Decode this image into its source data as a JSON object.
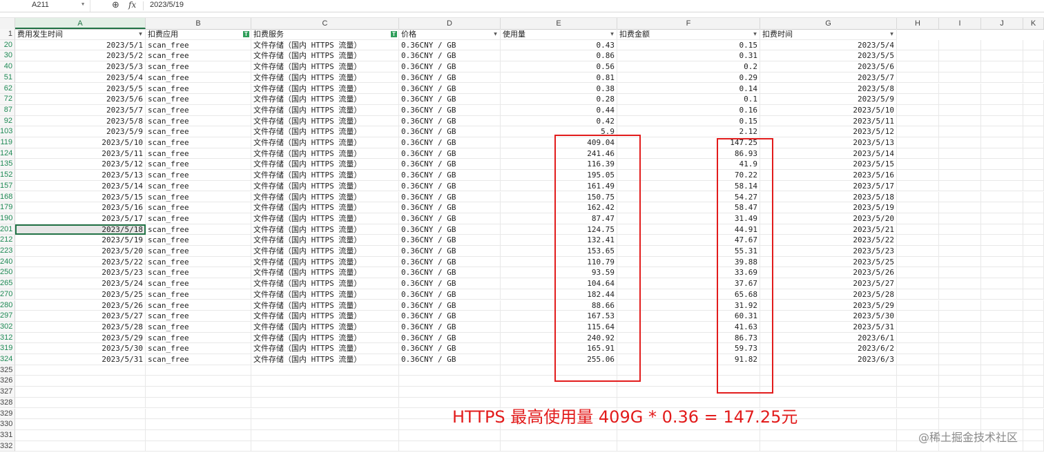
{
  "formula_bar": {
    "cell_ref": "A211",
    "formula": "2023/5/19"
  },
  "columns": [
    "A",
    "B",
    "C",
    "D",
    "E",
    "F",
    "G",
    "H",
    "I",
    "J",
    "K"
  ],
  "headers": [
    "费用发生时间",
    "扣费应用",
    "扣费服务",
    "价格",
    "使用量",
    "扣费金额",
    "扣费时间"
  ],
  "header_row_num": "1",
  "rows": [
    {
      "num": "20",
      "date": "2023/5/1",
      "app": "scan_free",
      "service": "文件存储（国内 HTTPS 流量）",
      "price": "0.36CNY / GB",
      "usage": "0.43",
      "amount": "0.15",
      "charge_time": "2023/5/4"
    },
    {
      "num": "30",
      "date": "2023/5/2",
      "app": "scan_free",
      "service": "文件存储（国内 HTTPS 流量）",
      "price": "0.36CNY / GB",
      "usage": "0.86",
      "amount": "0.31",
      "charge_time": "2023/5/5"
    },
    {
      "num": "40",
      "date": "2023/5/3",
      "app": "scan_free",
      "service": "文件存储（国内 HTTPS 流量）",
      "price": "0.36CNY / GB",
      "usage": "0.56",
      "amount": "0.2",
      "charge_time": "2023/5/6"
    },
    {
      "num": "51",
      "date": "2023/5/4",
      "app": "scan_free",
      "service": "文件存储（国内 HTTPS 流量）",
      "price": "0.36CNY / GB",
      "usage": "0.81",
      "amount": "0.29",
      "charge_time": "2023/5/7"
    },
    {
      "num": "62",
      "date": "2023/5/5",
      "app": "scan_free",
      "service": "文件存储（国内 HTTPS 流量）",
      "price": "0.36CNY / GB",
      "usage": "0.38",
      "amount": "0.14",
      "charge_time": "2023/5/8"
    },
    {
      "num": "72",
      "date": "2023/5/6",
      "app": "scan_free",
      "service": "文件存储（国内 HTTPS 流量）",
      "price": "0.36CNY / GB",
      "usage": "0.28",
      "amount": "0.1",
      "charge_time": "2023/5/9"
    },
    {
      "num": "87",
      "date": "2023/5/7",
      "app": "scan_free",
      "service": "文件存储（国内 HTTPS 流量）",
      "price": "0.36CNY / GB",
      "usage": "0.44",
      "amount": "0.16",
      "charge_time": "2023/5/10"
    },
    {
      "num": "92",
      "date": "2023/5/8",
      "app": "scan_free",
      "service": "文件存储（国内 HTTPS 流量）",
      "price": "0.36CNY / GB",
      "usage": "0.42",
      "amount": "0.15",
      "charge_time": "2023/5/11"
    },
    {
      "num": "103",
      "date": "2023/5/9",
      "app": "scan_free",
      "service": "文件存储（国内 HTTPS 流量）",
      "price": "0.36CNY / GB",
      "usage": "5.9",
      "amount": "2.12",
      "charge_time": "2023/5/12"
    },
    {
      "num": "119",
      "date": "2023/5/10",
      "app": "scan_free",
      "service": "文件存储（国内 HTTPS 流量）",
      "price": "0.36CNY / GB",
      "usage": "409.04",
      "amount": "147.25",
      "charge_time": "2023/5/13"
    },
    {
      "num": "124",
      "date": "2023/5/11",
      "app": "scan_free",
      "service": "文件存储（国内 HTTPS 流量）",
      "price": "0.36CNY / GB",
      "usage": "241.46",
      "amount": "86.93",
      "charge_time": "2023/5/14"
    },
    {
      "num": "135",
      "date": "2023/5/12",
      "app": "scan_free",
      "service": "文件存储（国内 HTTPS 流量）",
      "price": "0.36CNY / GB",
      "usage": "116.39",
      "amount": "41.9",
      "charge_time": "2023/5/15"
    },
    {
      "num": "152",
      "date": "2023/5/13",
      "app": "scan_free",
      "service": "文件存储（国内 HTTPS 流量）",
      "price": "0.36CNY / GB",
      "usage": "195.05",
      "amount": "70.22",
      "charge_time": "2023/5/16"
    },
    {
      "num": "157",
      "date": "2023/5/14",
      "app": "scan_free",
      "service": "文件存储（国内 HTTPS 流量）",
      "price": "0.36CNY / GB",
      "usage": "161.49",
      "amount": "58.14",
      "charge_time": "2023/5/17"
    },
    {
      "num": "168",
      "date": "2023/5/15",
      "app": "scan_free",
      "service": "文件存储（国内 HTTPS 流量）",
      "price": "0.36CNY / GB",
      "usage": "150.75",
      "amount": "54.27",
      "charge_time": "2023/5/18"
    },
    {
      "num": "179",
      "date": "2023/5/16",
      "app": "scan_free",
      "service": "文件存储（国内 HTTPS 流量）",
      "price": "0.36CNY / GB",
      "usage": "162.42",
      "amount": "58.47",
      "charge_time": "2023/5/19"
    },
    {
      "num": "190",
      "date": "2023/5/17",
      "app": "scan_free",
      "service": "文件存储（国内 HTTPS 流量）",
      "price": "0.36CNY / GB",
      "usage": "87.47",
      "amount": "31.49",
      "charge_time": "2023/5/20"
    },
    {
      "num": "201",
      "date": "2023/5/18",
      "app": "scan_free",
      "service": "文件存储（国内 HTTPS 流量）",
      "price": "0.36CNY / GB",
      "usage": "124.75",
      "amount": "44.91",
      "charge_time": "2023/5/21"
    },
    {
      "num": "212",
      "date": "2023/5/19",
      "app": "scan_free",
      "service": "文件存储（国内 HTTPS 流量）",
      "price": "0.36CNY / GB",
      "usage": "132.41",
      "amount": "47.67",
      "charge_time": "2023/5/22"
    },
    {
      "num": "223",
      "date": "2023/5/20",
      "app": "scan_free",
      "service": "文件存储（国内 HTTPS 流量）",
      "price": "0.36CNY / GB",
      "usage": "153.65",
      "amount": "55.31",
      "charge_time": "2023/5/23"
    },
    {
      "num": "240",
      "date": "2023/5/22",
      "app": "scan_free",
      "service": "文件存储（国内 HTTPS 流量）",
      "price": "0.36CNY / GB",
      "usage": "110.79",
      "amount": "39.88",
      "charge_time": "2023/5/25"
    },
    {
      "num": "250",
      "date": "2023/5/23",
      "app": "scan_free",
      "service": "文件存储（国内 HTTPS 流量）",
      "price": "0.36CNY / GB",
      "usage": "93.59",
      "amount": "33.69",
      "charge_time": "2023/5/26"
    },
    {
      "num": "265",
      "date": "2023/5/24",
      "app": "scan_free",
      "service": "文件存储（国内 HTTPS 流量）",
      "price": "0.36CNY / GB",
      "usage": "104.64",
      "amount": "37.67",
      "charge_time": "2023/5/27"
    },
    {
      "num": "270",
      "date": "2023/5/25",
      "app": "scan_free",
      "service": "文件存储（国内 HTTPS 流量）",
      "price": "0.36CNY / GB",
      "usage": "182.44",
      "amount": "65.68",
      "charge_time": "2023/5/28"
    },
    {
      "num": "280",
      "date": "2023/5/26",
      "app": "scan_free",
      "service": "文件存储（国内 HTTPS 流量）",
      "price": "0.36CNY / GB",
      "usage": "88.66",
      "amount": "31.92",
      "charge_time": "2023/5/29"
    },
    {
      "num": "297",
      "date": "2023/5/27",
      "app": "scan_free",
      "service": "文件存储（国内 HTTPS 流量）",
      "price": "0.36CNY / GB",
      "usage": "167.53",
      "amount": "60.31",
      "charge_time": "2023/5/30"
    },
    {
      "num": "302",
      "date": "2023/5/28",
      "app": "scan_free",
      "service": "文件存储（国内 HTTPS 流量）",
      "price": "0.36CNY / GB",
      "usage": "115.64",
      "amount": "41.63",
      "charge_time": "2023/5/31"
    },
    {
      "num": "312",
      "date": "2023/5/29",
      "app": "scan_free",
      "service": "文件存储（国内 HTTPS 流量）",
      "price": "0.36CNY / GB",
      "usage": "240.92",
      "amount": "86.73",
      "charge_time": "2023/6/1"
    },
    {
      "num": "319",
      "date": "2023/5/30",
      "app": "scan_free",
      "service": "文件存储（国内 HTTPS 流量）",
      "price": "0.36CNY / GB",
      "usage": "165.91",
      "amount": "59.73",
      "charge_time": "2023/6/2"
    },
    {
      "num": "324",
      "date": "2023/5/31",
      "app": "scan_free",
      "service": "文件存储（国内 HTTPS 流量）",
      "price": "0.36CNY / GB",
      "usage": "255.06",
      "amount": "91.82",
      "charge_time": "2023/6/3"
    }
  ],
  "empty_rows": [
    "325",
    "326",
    "327",
    "328",
    "329",
    "330",
    "331",
    "332"
  ],
  "annotation": "HTTPS 最高使用量 409G * 0.36 = 147.25元",
  "watermark": "@稀土掘金技术社区",
  "colors": {
    "accent": "#217346",
    "annotation_red": "#e21b1b",
    "filter_green": "#2f9e5a"
  }
}
